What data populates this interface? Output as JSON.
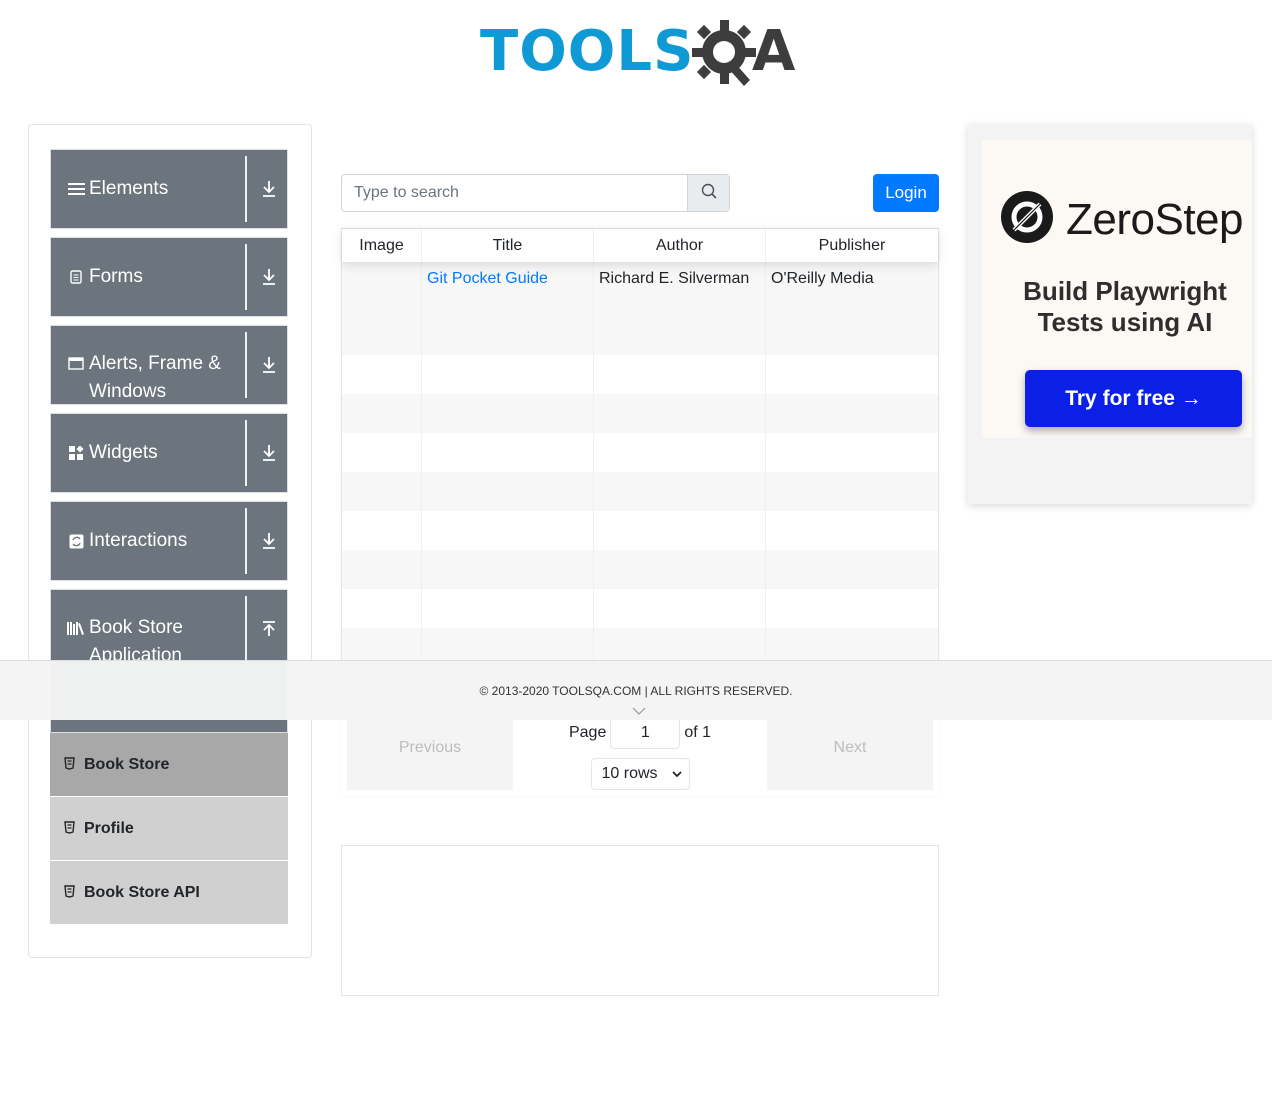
{
  "header": {
    "logo_text_left": "TOOLS",
    "logo_text_right": "A"
  },
  "sidebar": {
    "groups": [
      {
        "label": "Elements",
        "icon": "menu-icon"
      },
      {
        "label": "Forms",
        "icon": "document-icon"
      },
      {
        "label": "Alerts, Frame & Windows",
        "icon": "window-icon"
      },
      {
        "label": "Widgets",
        "icon": "widgets-icon"
      },
      {
        "label": "Interactions",
        "icon": "interactions-icon"
      },
      {
        "label": "Book Store Application",
        "icon": "books-icon"
      }
    ],
    "submenu": [
      {
        "label": "Book Store",
        "active": true
      },
      {
        "label": "Profile",
        "active": false
      },
      {
        "label": "Book Store API",
        "active": false
      }
    ]
  },
  "search": {
    "placeholder": "Type to search"
  },
  "login_label": "Login",
  "table": {
    "columns": [
      "Image",
      "Title",
      "Author",
      "Publisher"
    ],
    "rows": [
      {
        "image": "",
        "title": "Git Pocket Guide",
        "author": "Richard E. Silverman",
        "publisher": "O'Reilly Media"
      }
    ]
  },
  "pagination": {
    "previous": "Previous",
    "next": "Next",
    "page_label": "Page",
    "page_value": "1",
    "of_label": "of 1",
    "rows_label": "10 rows"
  },
  "ad": {
    "brand": "ZeroStep",
    "headline": "Build Playwright Tests using AI",
    "cta": "Try for free →"
  },
  "footer": {
    "text": "© 2013-2020 TOOLSQA.COM | ALL RIGHTS RESERVED."
  },
  "colors": {
    "primary": "#007bff",
    "sidebar_group": "#6c757d",
    "logo_blue": "#0f9ad6",
    "ad_cta": "#0b1fe6"
  }
}
